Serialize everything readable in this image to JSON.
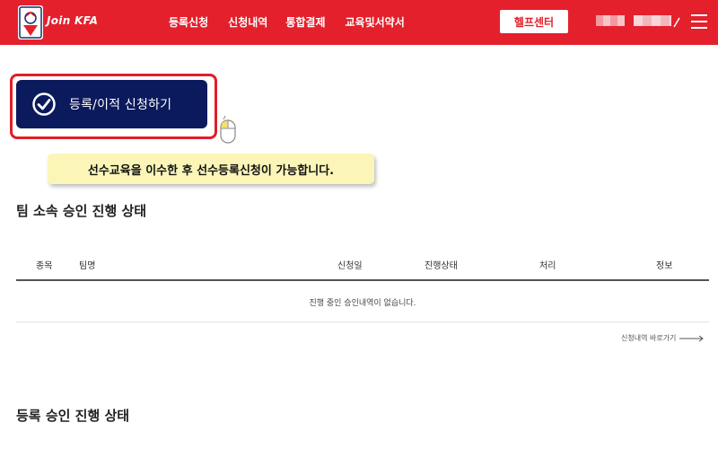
{
  "header": {
    "brand": "Join KFA",
    "nav": [
      {
        "label": "등록신청"
      },
      {
        "label": "신청내역"
      },
      {
        "label": "통합결제"
      },
      {
        "label": "교육및서약서"
      }
    ],
    "help_label": "헬프센터",
    "icons": {
      "logo": "kfa-emblem-icon",
      "user": "user-icon",
      "menu": "hamburger-menu-icon"
    },
    "accent_color": "#e4202c"
  },
  "register": {
    "label": "등록/이적 신청하기",
    "icon": "check-circle-icon",
    "color": "#0b1a5c"
  },
  "note": {
    "text": "선수교육을 이수한 후 선수등록신청이 가능합니다."
  },
  "team_section": {
    "title": "팀 소속 승인 진행 상태",
    "columns": [
      "종목",
      "팀명",
      "신청일",
      "진행상태",
      "처리",
      "정보"
    ],
    "empty_message": "진행 중인 승인내역이 없습니다.",
    "link_label": "신청내역 바로가기"
  },
  "registration_section": {
    "title": "등록 승인 진행 상태"
  }
}
